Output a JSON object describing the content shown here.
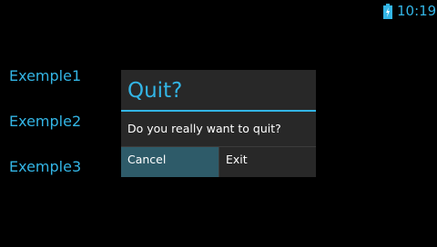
{
  "status_bar": {
    "time": "10:19",
    "battery_icon": "battery-charging-icon"
  },
  "list": {
    "items": [
      "Exemple1",
      "Exemple2",
      "Exemple3"
    ]
  },
  "dialog": {
    "title": "Quit?",
    "message": "Do you really want to quit?",
    "negative_label": "Cancel",
    "positive_label": "Exit"
  },
  "colors": {
    "accent": "#33b5e5",
    "background": "#000000",
    "dialog_background": "#282828",
    "button_pressed": "#2e5b69",
    "text": "#ffffff"
  }
}
